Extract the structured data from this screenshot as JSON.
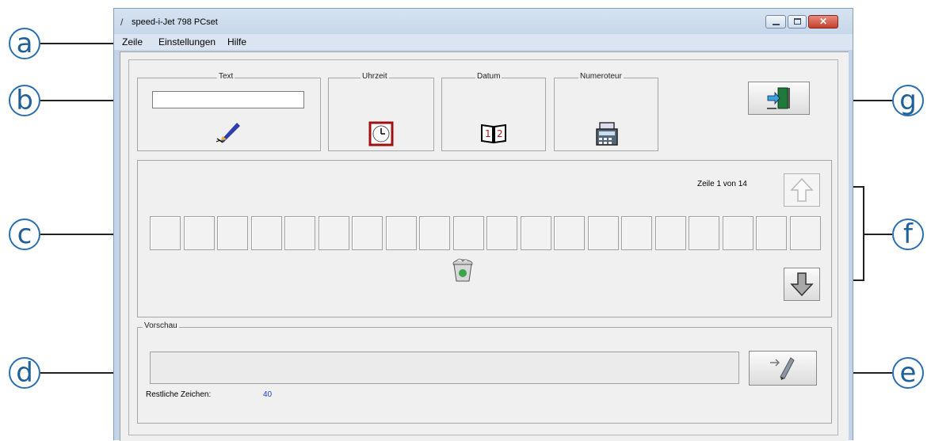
{
  "window": {
    "title": "speed-i-Jet 798 PCset",
    "close_glyph": "✕"
  },
  "menu": {
    "items": [
      {
        "label": "Zeile"
      },
      {
        "label": "Einstellungen"
      },
      {
        "label": "Hilfe"
      }
    ]
  },
  "groups": {
    "text": "Text",
    "time": "Uhrzeit",
    "date": "Datum",
    "numbering": "Numeroteur"
  },
  "line_panel": {
    "row_info": "Zeile 1 von 14",
    "cell_count": 20
  },
  "preview": {
    "label": "Vorschau",
    "remaining_label": "Restliche Zeichen:",
    "remaining_value": "40"
  },
  "callouts": {
    "a": "a",
    "b": "b",
    "c": "c",
    "d": "d",
    "e": "e",
    "f": "f",
    "g": "g"
  },
  "icons": {
    "text": "pen-icon",
    "time": "clock-icon",
    "date": "calendar-icon",
    "numbering": "numbering-stamp-icon",
    "exit": "exit-door-icon",
    "up": "arrow-up-icon",
    "down": "arrow-down-icon",
    "delete": "recycle-bin-icon",
    "print": "print-pen-icon"
  },
  "colors": {
    "accent": "#2a6fb0",
    "remaining_value": "#1a3fd0"
  }
}
